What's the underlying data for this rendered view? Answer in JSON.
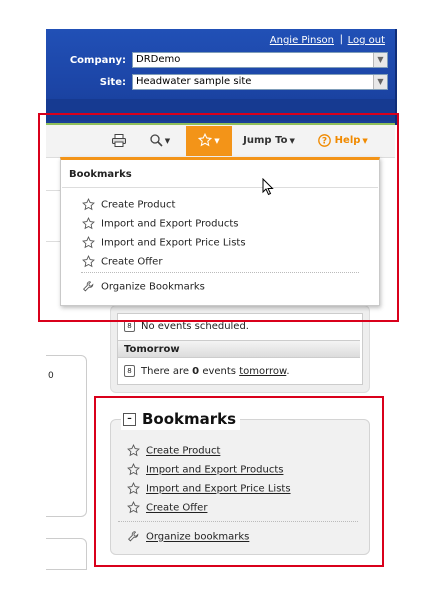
{
  "header": {
    "user_name": "Angie Pinson",
    "separator": "|",
    "logout": "Log out",
    "company_label": "Company:",
    "company_value": "DRDemo",
    "site_label": "Site:",
    "site_value": "Headwater sample site"
  },
  "toolbar": {
    "print_icon": "printer-icon",
    "search_icon": "magnifier-icon",
    "bookmark_icon": "star-icon",
    "jump_to": "Jump To",
    "help": "Help",
    "help_icon": "question-circle-icon",
    "active_color": "#f39418"
  },
  "dropdown": {
    "title": "Bookmarks",
    "items": [
      {
        "label": "Create Product",
        "icon": "star-outline-icon"
      },
      {
        "label": "Import and Export Products",
        "icon": "star-outline-icon"
      },
      {
        "label": "Import and Export Price Lists",
        "icon": "star-outline-icon"
      },
      {
        "label": "Create Offer",
        "icon": "star-outline-icon"
      }
    ],
    "organize": {
      "label": "Organize Bookmarks",
      "icon": "wrench-icon"
    }
  },
  "events": {
    "none_text": "No events scheduled.",
    "tomorrow_header": "Tomorrow",
    "tomorrow_prefix": "There are ",
    "tomorrow_count": "0",
    "tomorrow_mid": " events ",
    "tomorrow_link": "tomorrow",
    "tomorrow_suffix": "."
  },
  "left_panel": {
    "value": "0"
  },
  "bookmarks_panel": {
    "title": "Bookmarks",
    "collapse_symbol": "–",
    "items": [
      {
        "label": "Create Product"
      },
      {
        "label": "Import and Export Products"
      },
      {
        "label": "Import and Export Price Lists"
      },
      {
        "label": "Create Offer"
      }
    ],
    "organize": "Organize bookmarks"
  },
  "highlight_color": "#d9001b"
}
